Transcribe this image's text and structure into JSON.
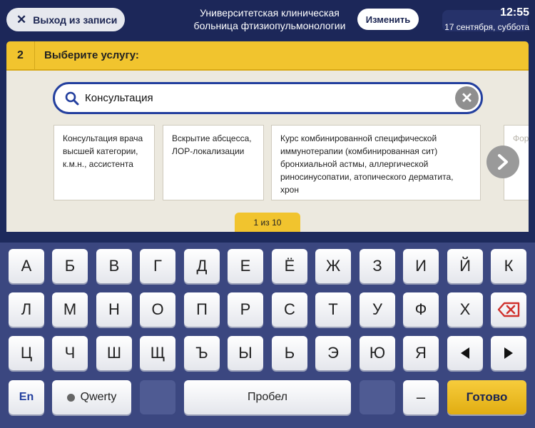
{
  "header": {
    "exit_label": "Выход из записи",
    "hospital_name": "Университетская клиническая больница фтизиопульмонологии",
    "change_label": "Изменить",
    "time": "12:55",
    "date": "17 сентября, суббота"
  },
  "step": {
    "number": "2",
    "title": "Выберите услугу:"
  },
  "search": {
    "value": "Консультация"
  },
  "services": [
    {
      "text": "Консультация врача высшей категории, к.м.н., ассистента"
    },
    {
      "text": "Вскрытие абсцесса, ЛОР-локализации"
    },
    {
      "text": "Курс комбинированной специфической иммунотерапии (комбинированная сит) бронхиальной астмы, аллергической риносинусопатии, атопического дерматита, хрон"
    },
    {
      "text": "Фор одн гипе"
    }
  ],
  "pager": "1 из 10",
  "keyboard": {
    "row1": [
      "А",
      "Б",
      "В",
      "Г",
      "Д",
      "Е",
      "Ё",
      "Ж",
      "З",
      "И",
      "Й",
      "К"
    ],
    "row2": [
      "Л",
      "М",
      "Н",
      "О",
      "П",
      "Р",
      "С",
      "Т",
      "У",
      "Ф",
      "Х"
    ],
    "row3": [
      "Ц",
      "Ч",
      "Ш",
      "Щ",
      "Ъ",
      "Ы",
      "Ь",
      "Э",
      "Ю",
      "Я"
    ],
    "lang": "En",
    "qwerty": "Qwerty",
    "space": "Пробел",
    "dash": "–",
    "done": "Готово"
  },
  "colors": {
    "accent": "#f1c42e",
    "header_bg": "#1c2759",
    "keyboard_bg": "#3b4780",
    "search_border": "#233f9e"
  }
}
